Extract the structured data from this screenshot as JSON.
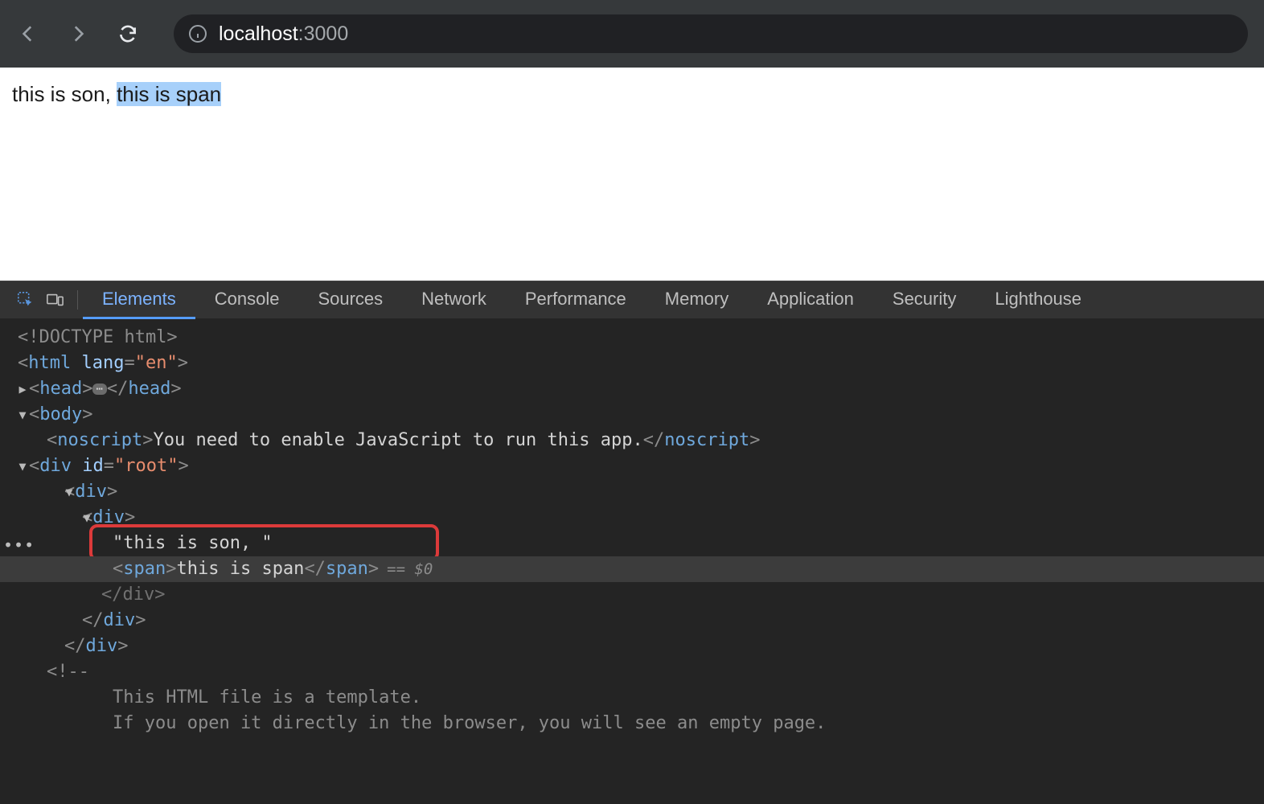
{
  "browser": {
    "url_host": "localhost",
    "url_port": ":3000"
  },
  "page": {
    "text_plain": "this is son, ",
    "text_highlighted": "this is span"
  },
  "devtools": {
    "tabs": [
      "Elements",
      "Console",
      "Sources",
      "Network",
      "Performance",
      "Memory",
      "Application",
      "Security",
      "Lighthouse"
    ],
    "active_tab": "Elements",
    "dom": {
      "doctype": "<!DOCTYPE html>",
      "html_open_1": "<",
      "html_open_2": "html",
      "html_lang_attr": "lang",
      "html_lang_val": "\"en\"",
      "html_open_end": ">",
      "head_open": "<head>",
      "head_ellipsis": "⋯",
      "head_close": "</head>",
      "body_open": "<body>",
      "noscript_open": "<noscript>",
      "noscript_text": "You need to enable JavaScript to run this app.",
      "noscript_close": "</noscript>",
      "root_open_1": "<",
      "root_open_2": "div",
      "root_id_attr": "id",
      "root_id_val": "\"root\"",
      "root_open_end": ">",
      "outer_div_open": "<div>",
      "inner_div_open": "<div>",
      "text_node": "\"this is son, \"",
      "span_open": "<span>",
      "span_text": "this is span",
      "span_close": "</span>",
      "selected_indicator": "== $0",
      "inner_div_close": "</div>",
      "outer_div_close": "</div>",
      "root_close": "</div>",
      "comment_open": "<!--",
      "comment_l1": "This HTML file is a template.",
      "comment_l2": "If you open it directly in the browser, you will see an empty page."
    }
  }
}
